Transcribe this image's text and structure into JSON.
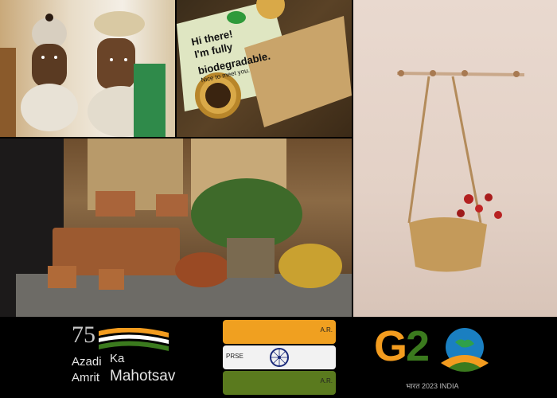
{
  "card": {
    "line1": "Hi there!",
    "line2": "I'm fully",
    "line3": "biodegradable.",
    "line4": "Nice to meet you."
  },
  "azadi": {
    "number": "75",
    "word1": "Azadi",
    "word2": "Ka",
    "word3": "Amrit",
    "word4": "Mahotsav"
  },
  "g20": {
    "g": "G",
    "two": "2",
    "sub": "भारत 2023 INDIA"
  },
  "spools": {
    "labels": [
      "A.R.",
      "PRSE",
      "A.R."
    ]
  },
  "colors": {
    "saffron": "#f39c1f",
    "green": "#3b7a1e",
    "navy": "#1b2a7a",
    "g20_blue": "#1a7fc1"
  }
}
